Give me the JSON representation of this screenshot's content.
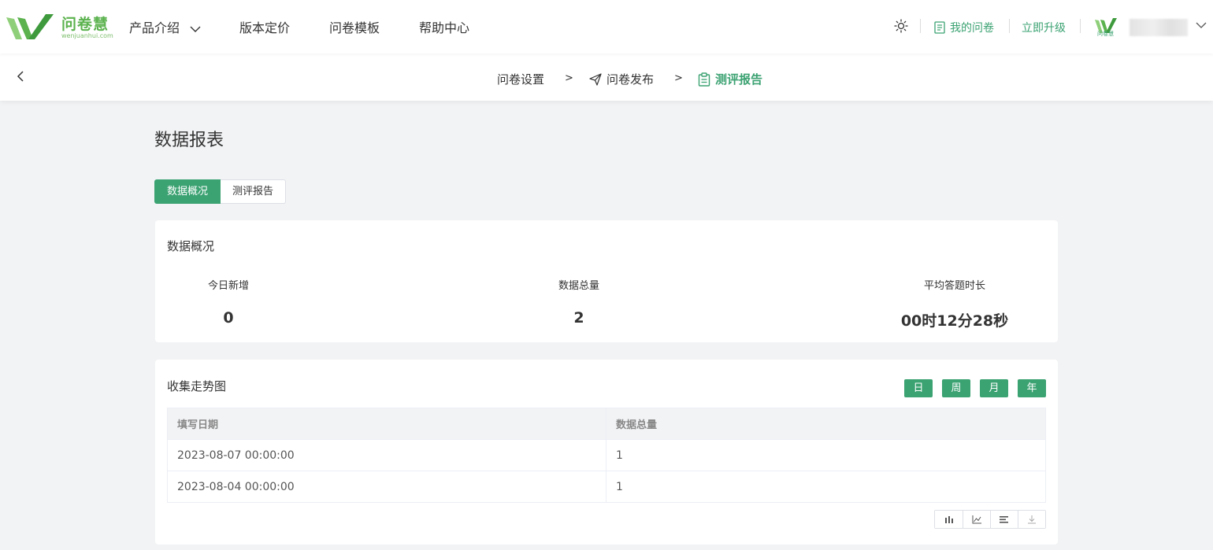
{
  "header": {
    "logo_text": "问卷慧",
    "logo_sub": "wenjuanhui.com",
    "nav": [
      {
        "label": "产品介绍",
        "has_dropdown": true
      },
      {
        "label": "版本定价"
      },
      {
        "label": "问卷模板"
      },
      {
        "label": "帮助中心"
      }
    ],
    "my_survey": "我的问卷",
    "upgrade": "立即升级",
    "avatar_text": "问卷慧",
    "icons": [
      "sun-icon",
      "document-icon",
      "chevron-down-icon"
    ]
  },
  "steps": [
    {
      "label": "问卷设置",
      "icon": "",
      "active": false
    },
    {
      "label": "问卷发布",
      "icon": "send-icon",
      "active": false
    },
    {
      "label": "测评报告",
      "icon": "clipboard-icon",
      "active": true
    }
  ],
  "step_separator": ">",
  "page": {
    "title": "数据报表",
    "tabs": [
      {
        "label": "数据概况",
        "active": true
      },
      {
        "label": "测评报告",
        "active": false
      }
    ]
  },
  "overview": {
    "title": "数据概况",
    "stats": [
      {
        "label": "今日新增",
        "value": "0"
      },
      {
        "label": "数据总量",
        "value": "2"
      },
      {
        "label": "平均答题时长",
        "value": "00时12分28秒"
      }
    ]
  },
  "trend": {
    "title": "收集走势图",
    "periods": [
      "日",
      "周",
      "月",
      "年"
    ],
    "columns": [
      "填写日期",
      "数据总量"
    ],
    "rows": [
      [
        "2023-08-07 00:00:00",
        "1"
      ],
      [
        "2023-08-04 00:00:00",
        "1"
      ]
    ],
    "tools": [
      "bar-chart-icon",
      "line-chart-icon",
      "data-view-icon",
      "download-icon"
    ]
  },
  "colors": {
    "accent": "#3ba272",
    "logo_green": "#5bb24e",
    "background": "#f2f3f5"
  }
}
